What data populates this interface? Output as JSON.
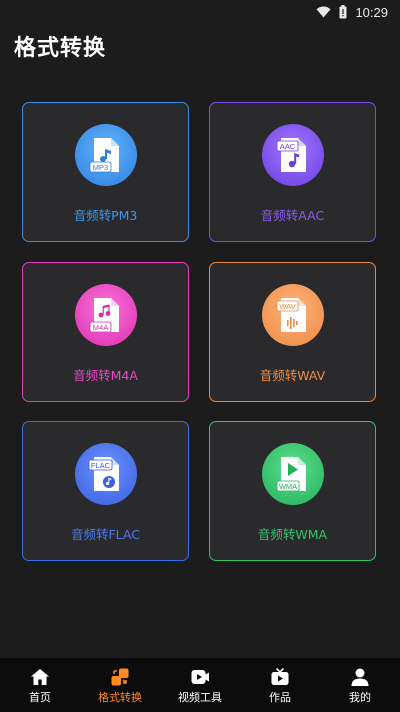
{
  "status_bar": {
    "time": "10:29",
    "icons": [
      "wifi-icon",
      "battery-icon"
    ]
  },
  "page": {
    "title": "格式转换"
  },
  "formats": [
    {
      "label": "音频转PM3",
      "badge": "MP3",
      "color": "#3a8ee6",
      "text_color": "#3d95ec"
    },
    {
      "label": "音频转AAC",
      "badge": "AAC",
      "color": "#7a4de8",
      "text_color": "#8a5cf0"
    },
    {
      "label": "音频转M4A",
      "badge": "M4A",
      "color": "#e63ec0",
      "text_color": "#e846c6"
    },
    {
      "label": "音频转WAV",
      "badge": "WAV",
      "color": "#f0883a",
      "text_color": "#f28d3e"
    },
    {
      "label": "音频转FLAC",
      "badge": "FLAC",
      "color": "#3a6ee6",
      "text_color": "#4a78ec"
    },
    {
      "label": "音频转WMA",
      "badge": "WMA",
      "color": "#2ec26a",
      "text_color": "#34c46e"
    }
  ],
  "bottom_nav": {
    "items": [
      {
        "label": "首页",
        "icon": "home-icon"
      },
      {
        "label": "格式转换",
        "icon": "convert-icon"
      },
      {
        "label": "视频工具",
        "icon": "video-tool-icon"
      },
      {
        "label": "作品",
        "icon": "works-tv-icon"
      },
      {
        "label": "我的",
        "icon": "profile-icon"
      }
    ],
    "active_label": "格式转换",
    "active_color": "#ff8a1e"
  }
}
